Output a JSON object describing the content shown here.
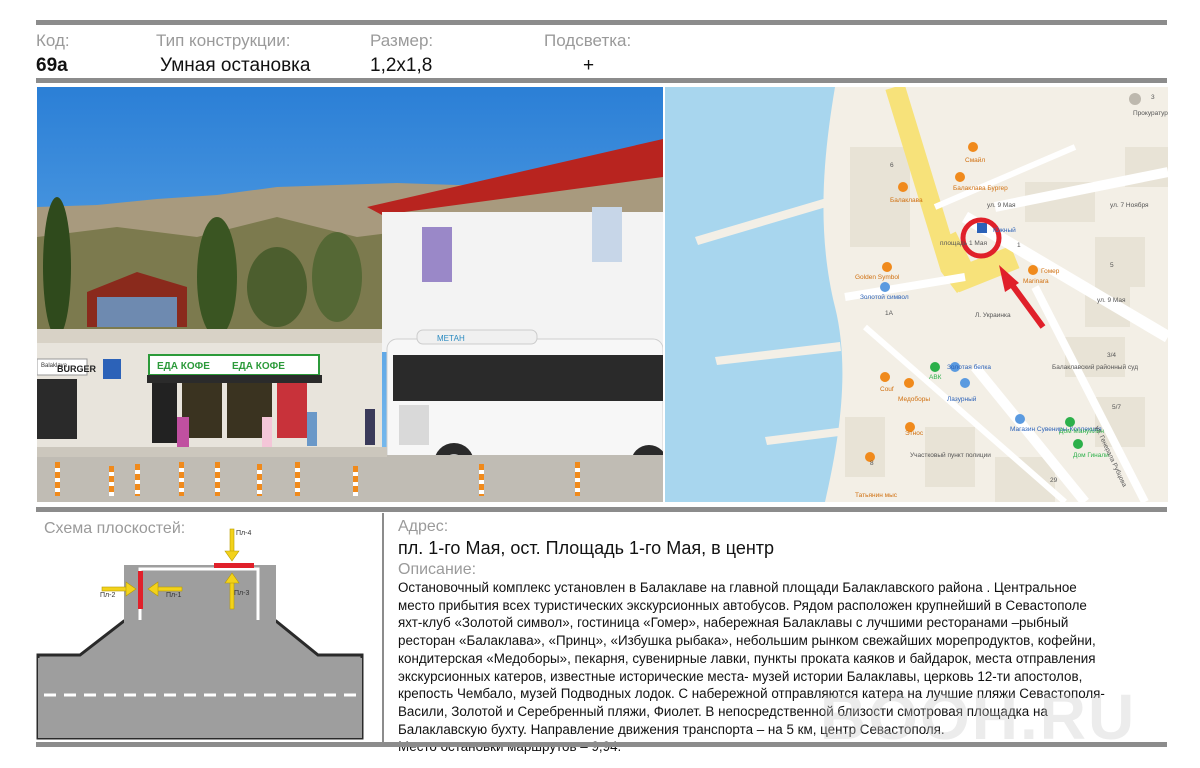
{
  "header": {
    "code_label": "Код:",
    "code_value": "69а",
    "type_label": "Тип конструкции:",
    "type_value": "Умная остановка",
    "size_label": "Размер:",
    "size_value": "1,2х1,8",
    "light_label": "Подсветка:",
    "light_value": "+"
  },
  "photo": {
    "shop_sign_left": "BURGER",
    "shop_sign_sub": "Balaklava",
    "kiosk_sign_1": "ЕДА КОФЕ",
    "kiosk_sign_2": "ЕДА КОФЕ",
    "bus_label": "МЕТАН"
  },
  "map": {
    "labels": {
      "prokuratura": "Прокуратура Балаклавского района",
      "lbl_3": "3",
      "smile": "Смайл",
      "balaklava_burger": "Балаклава Бургер",
      "balaklava": "Балаклава",
      "lbl_6": "6",
      "ul_9_maya_1": "ул. 9 Мая",
      "ul_7_noyabrya": "ул. 7 Ноября",
      "yuzhny": "Южный",
      "ploshad": "площадь 1 Мая",
      "lbl_1": "1",
      "gomer": "Гомер",
      "marinara": "Marinara",
      "golden_symbol": "Golden Symbol",
      "zolotoy_simvol": "Золотой символ",
      "lbl_1a": "1А",
      "ukrainka": "Л. Украинка",
      "ul_9_maya_2": "ул. 9 Мая",
      "lbl_5": "5",
      "lbl_34": "3/4",
      "zolotaya_belka": "Золотая белка",
      "avk": "АВК",
      "sosh": "Соuf",
      "medobory": "Медоборы",
      "lazurny": "Лазурный",
      "sud": "Балаклавский районный суд",
      "lbl_57": "5/7",
      "magazin": "Магазин Сувениры-Коллекция",
      "dom_manuylin": "Дом Мануйлин",
      "dom_ginali": "Дом Гинали",
      "ul_rubtsova": "ул. Генерала Рубцова",
      "etnos": "Этнос",
      "punkt_policii": "Участковый пункт полиции",
      "lbl_8": "8",
      "tatyanin": "Татьянин мыс",
      "lbl_29": "29"
    }
  },
  "scheme": {
    "title": "Схема плоскостей:",
    "pl1": "Пл-1",
    "pl2": "Пл-2",
    "pl3": "Пл-3",
    "pl4": "Пл-4"
  },
  "address": {
    "label": "Адрес:",
    "value": "пл. 1-го Мая, ост. Площадь 1-го Мая,  в центр"
  },
  "description": {
    "label": "Описание:",
    "text": "Остановочный комплекс установлен  в Балаклаве  на главной площади Балаклавского района . Центральное\nместо прибытия всех туристических экскурсионных  автобусов. Рядом расположен крупнейший в Севастополе\nяхт-клуб «Золотой символ», гостиница «Гомер», набережная Балаклавы с  лучшими ресторанами –рыбный\nресторан «Балаклава», «Принц», «Избушка рыбака», небольшим рынком свежайших морепродуктов, кофейни,\nкондитерская «Медоборы», пекарня,  сувенирные лавки, пункты проката каяков и байдарок, места отправления\nэкскурсионных катеров, известные исторические места- музей истории Балаклавы, церковь 12-ти апостолов,\nкрепость Чембало, музей Подводных лодок. С набережной отправляются катера на лучшие пляжи Севастополя-\nВасили, Золотой и Серебренный пляжи, Фиолет. В непосредственной близости  смотровая площадка на\nБалаклавскую бухту. Направление движения транспорта  –  на 5 км, центр Севастополя.\nМесто остановки маршрутов – 9,94."
  },
  "watermark": "BOOH.RU",
  "colors": {
    "rule": "#8c8c8c",
    "label_grey": "#9a9a9a",
    "plane_red": "#e0202a",
    "arrow_yellow": "#f3d21a",
    "map_water": "#a8d6ee",
    "map_road_yellow": "#f7e27a"
  }
}
